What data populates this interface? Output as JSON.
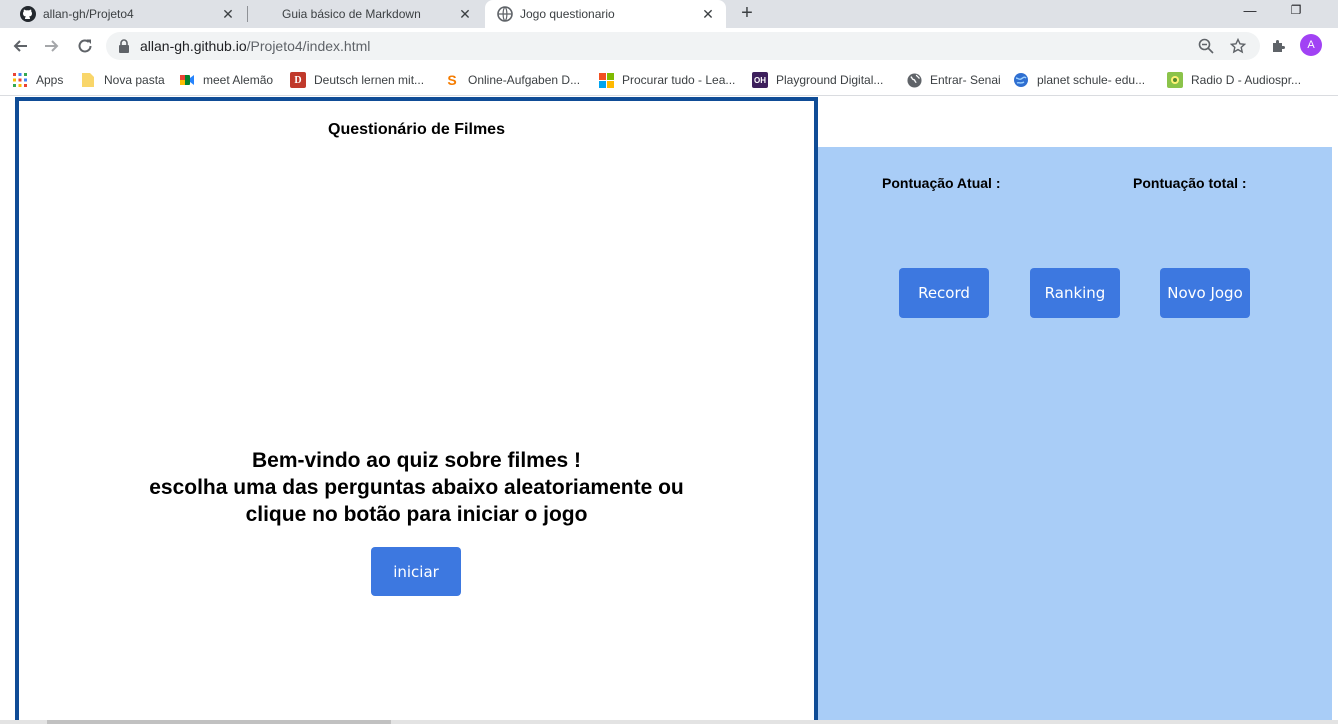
{
  "tabs": [
    {
      "title": "allan-gh/Projeto4",
      "favicon": "github-icon"
    },
    {
      "title": "Guia básico de Markdown",
      "favicon": "none"
    },
    {
      "title": "Jogo questionario",
      "favicon": "globe-icon",
      "active": true
    }
  ],
  "tab_close_glyph": "✕",
  "new_tab_glyph": "+",
  "window_controls": {
    "minimize": "—",
    "restore": "❐"
  },
  "address_bar": {
    "domain": "allan-gh.github.io",
    "path": "/Projeto4/index.html"
  },
  "profile_initial": "A",
  "bookmarks": [
    {
      "label": "Apps",
      "icon": "apps-grid-icon"
    },
    {
      "label": "Nova pasta",
      "icon": "folder-icon",
      "color": "#f9d66a"
    },
    {
      "label": "meet Alemão",
      "icon": "google-meet-icon"
    },
    {
      "label": "Deutsch lernen mit...",
      "icon": "d-logo-icon",
      "color": "#c0392b",
      "glyph": "D"
    },
    {
      "label": "Online-Aufgaben D...",
      "icon": "s-logo-icon",
      "color": "#f57c00",
      "glyph": "S"
    },
    {
      "label": "Procurar tudo - Lea...",
      "icon": "microsoft-icon"
    },
    {
      "label": "Playground Digital...",
      "icon": "oh-logo-icon",
      "color": "#3d1f5c",
      "glyph": "OH"
    },
    {
      "label": "Entrar- Senai",
      "icon": "globe-icon"
    },
    {
      "label": "planet schule- edu...",
      "icon": "planet-icon",
      "color": "#2f6fd1"
    },
    {
      "label": "Radio D - Audiospr...",
      "icon": "radio-d-icon",
      "color": "#8bc34a"
    }
  ],
  "quiz": {
    "title": "Questionário de Filmes",
    "welcome_lines": [
      "Bem-vindo ao quiz sobre filmes !",
      "escolha uma das perguntas abaixo aleatoriamente ou",
      "clique no botão para iniciar o jogo"
    ],
    "start_label": "iniciar"
  },
  "scoreboard": {
    "current_label": "Pontuação Atual :",
    "total_label": "Pontuação total :",
    "buttons": {
      "record": "Record",
      "ranking": "Ranking",
      "new_game": "Novo Jogo"
    }
  },
  "colors": {
    "quiz_border": "#0f4c96",
    "side_panel": "#a9cdf7",
    "button": "#3d78e0",
    "avatar": "#a142f4"
  }
}
